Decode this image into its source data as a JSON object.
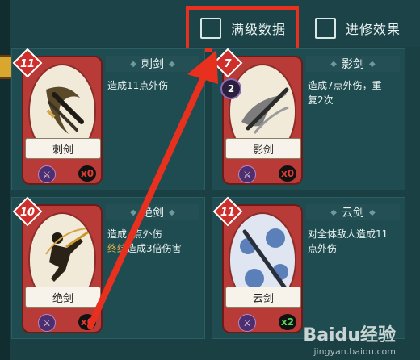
{
  "options": {
    "max_level": {
      "label": "满级数据",
      "checked": false
    },
    "upgrade": {
      "label": "进修效果",
      "checked": false
    }
  },
  "colors": {
    "highlight": "#e8301f",
    "background": "#1a4044",
    "card": "#b93b37"
  },
  "cards": [
    {
      "name": "刺剑",
      "title": "刺剑",
      "cost": "11",
      "count": "x0",
      "count_color": "#e03c36",
      "desc_lines": [
        "造成11点外伤"
      ],
      "hits": null
    },
    {
      "name": "影剑",
      "title": "影剑",
      "cost": "7",
      "count": "x0",
      "count_color": "#e03c36",
      "desc_lines": [
        "造成7点外伤，重",
        "复2次"
      ],
      "hits": "2"
    },
    {
      "name": "绝剑",
      "title": "绝剑",
      "cost": "10",
      "count": "x0",
      "count_color": "#e03c36",
      "desc_pre": "造成",
      "desc_after_hidden": "点外伤",
      "desc_keyword": "终结",
      "desc_rest": "造成3倍伤害",
      "title_visible": "绝剑",
      "hits": null
    },
    {
      "name": "云剑",
      "title": "云剑",
      "cost": "11",
      "count": "x2",
      "count_color": "#55d65a",
      "desc_lines": [
        "对全体敌人造成11",
        "点外伤"
      ],
      "hits": null
    }
  ],
  "watermark": {
    "brand": "Baidu经验",
    "url": "jingyan.baidu.com"
  }
}
